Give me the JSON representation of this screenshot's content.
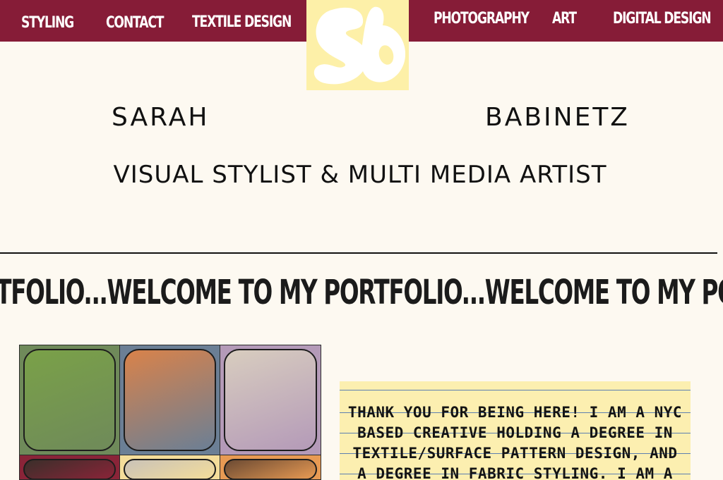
{
  "nav": {
    "left": [
      "STYLING",
      "CONTACT",
      "TEXTILE DESIGN"
    ],
    "right": [
      "PHOTOGRAPHY",
      "ART",
      "DIGITAL DESIGN"
    ]
  },
  "logo": {
    "text": "sb",
    "icon": "sb-monogram-logo"
  },
  "hero": {
    "first_name": "SARAH",
    "last_name": "BABINETZ",
    "tagline": "VISUAL STYLIST & MULTI MEDIA ARTIST"
  },
  "marquee": {
    "text": "RTFOLIO...WELCOME TO MY PORTFOLIO...WELCOME TO MY POR"
  },
  "gallery": {
    "cells": [
      {
        "bg": "#6f8a5a",
        "photo": "#7aa148"
      },
      {
        "bg": "#6b7f95",
        "photo": "#d9824a"
      },
      {
        "bg": "#b49ab8",
        "photo": "#d8cdbf"
      },
      {
        "bg": "#8a2438",
        "photo": "#3a2f2a"
      },
      {
        "bg": "#f4dd9a",
        "photo": "#c9c2b8"
      },
      {
        "bg": "#e89a53",
        "photo": "#6b4a33"
      }
    ]
  },
  "about": {
    "text": "THANK YOU FOR BEING HERE! I AM A NYC BASED CREATIVE HOLDING A DEGREE IN TEXTILE/SURFACE PATTERN DESIGN, AND A DEGREE IN FABRIC STYLING. I AM A"
  },
  "colors": {
    "nav_bg": "#861c37",
    "logo_bg": "#fdf0a8",
    "page_bg": "#fdf9f1",
    "note_bg": "#fcefb0"
  }
}
